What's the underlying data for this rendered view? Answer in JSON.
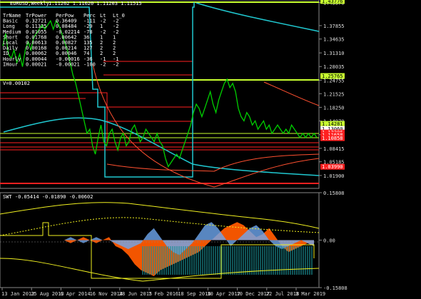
{
  "header": {
    "symbol_title": "EURUSD,Weekly",
    "ohlc": "1.11262 1.11620 1.11203 1.11515"
  },
  "stats_table": {
    "headers": [
      "TrName",
      "TrPower",
      "PerPow",
      "Perc",
      "Lt",
      "Lt_0"
    ],
    "rows": [
      [
        "Basic",
        "0.32721",
        "0.36409",
        "-111",
        "-2",
        "-2"
      ],
      [
        "Long",
        "0.11325",
        "0.08484",
        "-29",
        "1",
        "-2"
      ],
      [
        "Medium",
        "0.01055",
        "-0.02214",
        "-78",
        "-2",
        "-2"
      ],
      [
        "Short",
        "0.01768",
        "0.00642",
        "36",
        "1",
        "1"
      ],
      [
        "Local",
        "0.00613",
        "0.00827",
        "135",
        "2",
        "2"
      ],
      [
        "Daily",
        "0.00168",
        "0.00214",
        "127",
        "2",
        "2"
      ],
      [
        "ID",
        "0.00062",
        "0.00046",
        "74",
        "2",
        "2"
      ],
      [
        "Hourly",
        "0.00044",
        "-0.00016",
        "-36",
        "-1",
        "-1"
      ],
      [
        "IHour",
        "0.00021",
        "-0.00021",
        "-100",
        "-2",
        "-2"
      ]
    ],
    "vlabel": "V=0.00102"
  },
  "colors": {
    "background": "#000000",
    "candles": "#00d000",
    "cyan": "#20c8d0",
    "yellow": "#f0f020",
    "red": "#ff2020",
    "orange_fill": "#ff5a00",
    "blue_fill": "#6ea8f0",
    "teal_fill": "#1a8f94",
    "price_tag_bg": "#ff2020"
  },
  "chart_data": [
    {
      "type": "line",
      "title": "EURUSD,Weekly",
      "y_axis_ticks": [
        "1.43376",
        "1.37855",
        "1.34635",
        "1.31310",
        "1.28035",
        "1.24755",
        "1.21525",
        "1.18250",
        "1.14970",
        "1.11690",
        "1.08415",
        "1.05185",
        "1.01900"
      ],
      "ylim": [
        0.988,
        1.44
      ],
      "price_tags": [
        {
          "label": "1.43776",
          "value": 1.43776,
          "color": "#c8ff30"
        },
        {
          "label": "1.25765",
          "value": 1.25765,
          "color": "#c8ff30"
        },
        {
          "label": "1.14281",
          "value": 1.14281,
          "color": "#c8ff30"
        },
        {
          "label": "1.13060",
          "value": 1.1306,
          "color": "#ffffff"
        },
        {
          "label": "1.12206",
          "value": 1.12206,
          "color": "#ff2020"
        },
        {
          "label": "1.11658",
          "value": 1.11658,
          "color": "#ff2020"
        },
        {
          "label": "1.10858",
          "value": 1.10858,
          "color": "#ff2020"
        },
        {
          "label": "1.03990",
          "value": 1.0399,
          "color": "#ff2020"
        }
      ],
      "x_axis_labels": [
        "13 Jan 2013",
        "25 Aug 2013",
        "6 Apr 2014",
        "16 Nov 2014",
        "28 Jun 2015",
        "7 Feb 2016",
        "18 Sep 2016",
        "30 Apr 2017",
        "10 Dec 2017",
        "22 Jul 2018",
        "3 Mar 2019"
      ],
      "series": [
        {
          "color": "#00d000",
          "x": [
            0,
            3,
            6,
            9,
            12,
            15,
            18,
            21,
            24,
            27,
            30,
            33,
            36,
            39,
            42,
            45,
            48,
            51,
            54,
            57,
            60,
            63,
            66,
            69,
            72,
            75,
            78,
            81,
            84,
            87,
            90,
            93,
            96,
            99,
            102,
            105,
            108,
            111,
            114,
            117,
            120,
            123,
            126,
            129,
            132,
            135,
            138,
            141,
            144,
            147,
            150,
            153,
            156,
            159,
            162,
            165,
            168,
            171,
            174,
            177,
            180,
            183,
            186,
            189,
            192,
            195,
            198,
            201,
            204,
            207,
            210,
            213,
            216,
            219,
            222,
            225,
            228,
            231,
            234,
            237,
            240,
            243,
            246,
            249,
            252,
            255,
            258,
            261,
            264,
            267,
            270,
            273,
            276,
            279,
            282,
            285,
            288,
            291,
            294,
            297,
            300,
            303,
            306,
            309,
            312,
            315,
            318,
            321,
            324,
            327,
            330,
            333,
            336
          ],
          "values": [
            1.33,
            1.36,
            1.31,
            1.3,
            1.32,
            1.29,
            1.31,
            1.28,
            1.32,
            1.34,
            1.32,
            1.35,
            1.36,
            1.37,
            1.38,
            1.37,
            1.38,
            1.39,
            1.37,
            1.39,
            1.38,
            1.36,
            1.34,
            1.32,
            1.29,
            1.26,
            1.24,
            1.21,
            1.18,
            1.15,
            1.12,
            1.13,
            1.09,
            1.07,
            1.11,
            1.14,
            1.1,
            1.09,
            1.12,
            1.13,
            1.1,
            1.08,
            1.11,
            1.12,
            1.09,
            1.1,
            1.13,
            1.14,
            1.12,
            1.1,
            1.11,
            1.13,
            1.12,
            1.11,
            1.1,
            1.12,
            1.1,
            1.09,
            1.06,
            1.04,
            1.05,
            1.06,
            1.07,
            1.06,
            1.08,
            1.1,
            1.12,
            1.14,
            1.17,
            1.19,
            1.18,
            1.16,
            1.18,
            1.2,
            1.22,
            1.19,
            1.17,
            1.2,
            1.22,
            1.24,
            1.25,
            1.23,
            1.24,
            1.22,
            1.18,
            1.16,
            1.15,
            1.17,
            1.16,
            1.14,
            1.15,
            1.13,
            1.14,
            1.15,
            1.13,
            1.14,
            1.12,
            1.13,
            1.14,
            1.13,
            1.12,
            1.13,
            1.12,
            1.14,
            1.13,
            1.12,
            1.11,
            1.12,
            1.11,
            1.12,
            1.11,
            1.12,
            1.11
          ]
        }
      ]
    },
    {
      "type": "area",
      "title": "SWT",
      "header_values": "SWT -0.05414 -0.01890 -0.00602",
      "y_axis_ticks": [
        "0.15808",
        "0.00",
        "-0.15808"
      ],
      "ylim": [
        -0.158,
        0.158
      ],
      "series": [
        {
          "name": "SWT",
          "color": "#ff5a00",
          "values": [
            0.0,
            -0.01,
            0.0,
            0.01,
            0.0,
            -0.01,
            0.0,
            0.01,
            -0.02,
            -0.03,
            -0.05,
            -0.08,
            -0.1,
            -0.11,
            -0.12,
            -0.1,
            -0.09,
            -0.08,
            -0.07,
            -0.06,
            -0.05,
            -0.04,
            -0.02,
            0.0,
            0.02,
            0.04,
            0.05,
            0.06,
            0.05,
            0.03,
            0.01,
            0.02,
            0.04,
            0.01,
            -0.02,
            -0.04,
            -0.03,
            -0.02,
            -0.01,
            -0.02
          ]
        },
        {
          "color": "#6ea8f0",
          "values": [
            0.0,
            0.01,
            0.0,
            -0.01,
            0.0,
            0.01,
            0.0,
            0.0,
            -0.01,
            -0.02,
            -0.03,
            -0.02,
            -0.01,
            0.02,
            0.04,
            0.01,
            -0.02,
            -0.04,
            -0.05,
            -0.03,
            -0.01,
            0.02,
            0.05,
            0.06,
            0.04,
            0.01,
            -0.02,
            0.0,
            0.02,
            0.04,
            0.05,
            0.03,
            0.0,
            -0.02,
            -0.03,
            -0.02,
            -0.01,
            0.0,
            -0.01,
            -0.02
          ]
        }
      ]
    }
  ]
}
